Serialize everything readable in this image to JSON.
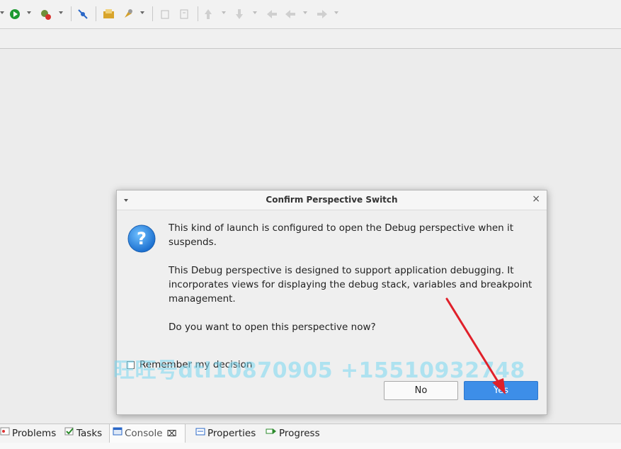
{
  "dialog": {
    "title": "Confirm Perspective Switch",
    "close_glyph": "×",
    "message_1": "This kind of launch is configured to open the Debug perspective when it suspends.",
    "message_2": "This Debug perspective is designed to support application debugging.  It incorporates views for displaying the debug stack, variables and breakpoint management.",
    "question": "Do you want to open this perspective now?",
    "remember_label": "Remember my decision",
    "remember_checked": false,
    "no_label": "No",
    "yes_label": "Yes",
    "icon": "question-icon"
  },
  "watermark": {
    "text": "旺旺号dtl10870905 +15510932748"
  },
  "bottom_tabs": [
    {
      "label": "Problems",
      "icon": "problems-icon"
    },
    {
      "label": "Tasks",
      "icon": "tasks-icon"
    },
    {
      "label": "Console",
      "icon": "console-icon",
      "active": true,
      "close_glyph": "⌧"
    },
    {
      "label": "Properties",
      "icon": "properties-icon"
    },
    {
      "label": "Progress",
      "icon": "progress-icon"
    }
  ],
  "toolbar": {
    "icons": [
      "run-icon",
      "debug-icon",
      "skip-breakpoints-icon",
      "open-file-icon",
      "pin-icon",
      "copy-icon",
      "paste-icon",
      "next-annotation-icon",
      "previous-annotation-icon",
      "back-icon",
      "forward-icon"
    ]
  },
  "colors": {
    "accent": "#3d8ee8",
    "arrow": "#e0202a",
    "watermark": "#78d7f0"
  }
}
